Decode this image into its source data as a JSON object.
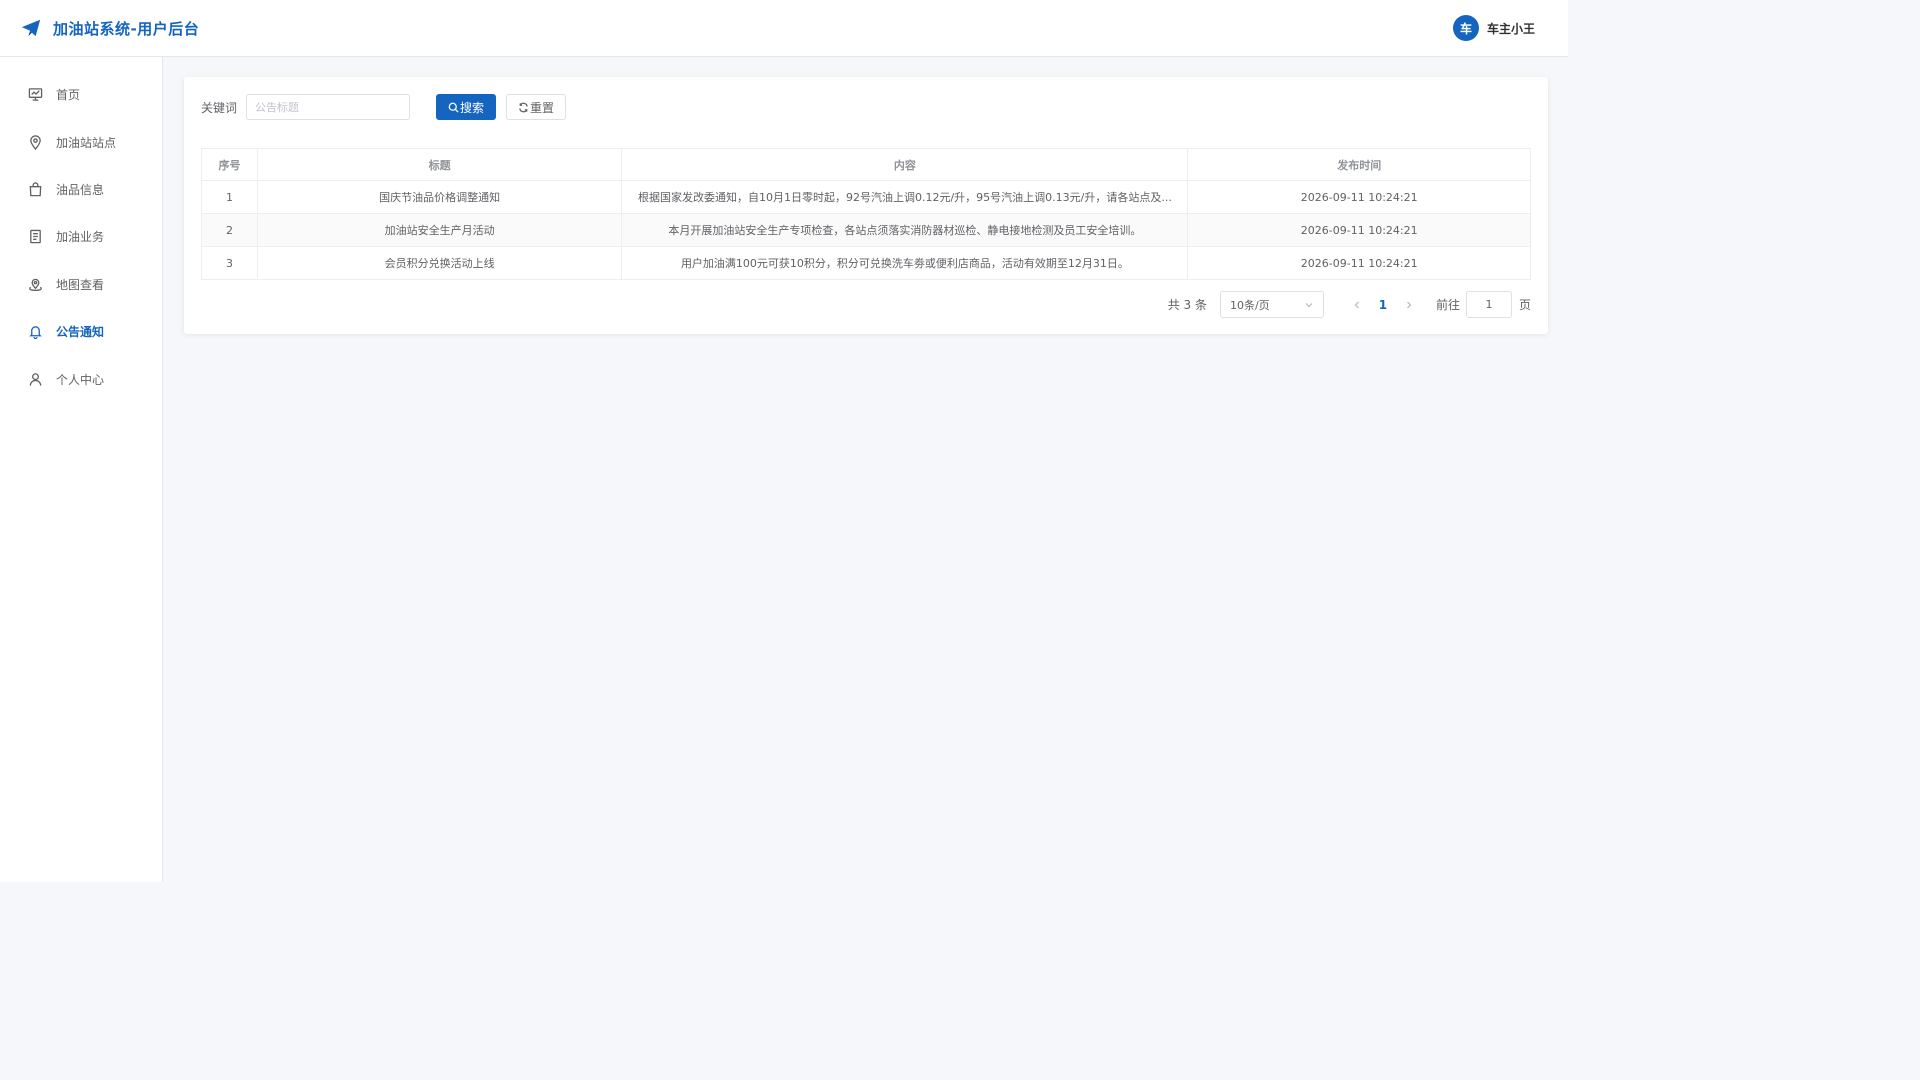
{
  "header": {
    "title": "加油站系统-用户后台",
    "user": {
      "avatar_text": "车",
      "name": "车主小王"
    }
  },
  "sidebar": {
    "items": [
      {
        "label": "首页",
        "icon": "dashboard-icon"
      },
      {
        "label": "加油站站点",
        "icon": "location-pin-icon"
      },
      {
        "label": "油品信息",
        "icon": "shopping-bag-icon"
      },
      {
        "label": "加油业务",
        "icon": "document-list-icon"
      },
      {
        "label": "地图查看",
        "icon": "map-pin-icon"
      },
      {
        "label": "公告通知",
        "icon": "bell-icon",
        "active": true
      },
      {
        "label": "个人中心",
        "icon": "user-icon"
      }
    ]
  },
  "search": {
    "label": "关键词",
    "placeholder": "公告标题",
    "value": "",
    "search_button": "搜索",
    "reset_button": "重置"
  },
  "table": {
    "columns": [
      "序号",
      "标题",
      "内容",
      "发布时间"
    ],
    "rows": [
      {
        "index": "1",
        "title": "国庆节油品价格调整通知",
        "content": "根据国家发改委通知，自10月1日零时起，92号汽油上调0.12元/升，95号汽油上调0.13元/升，请各站点及...",
        "time": "2026-09-11 10:24:21"
      },
      {
        "index": "2",
        "title": "加油站安全生产月活动",
        "content": "本月开展加油站安全生产专项检查，各站点须落实消防器材巡检、静电接地检测及员工安全培训。",
        "time": "2026-09-11 10:24:21"
      },
      {
        "index": "3",
        "title": "会员积分兑换活动上线",
        "content": "用户加油满100元可获10积分，积分可兑换洗车劵或便利店商品，活动有效期至12月31日。",
        "time": "2026-09-11 10:24:21"
      }
    ]
  },
  "pagination": {
    "total": "共 3 条",
    "page_size": "10条/页",
    "current_page": "1",
    "goto_label": "前往",
    "goto_value": "1",
    "page_suffix": "页"
  },
  "colors": {
    "brand": "#1565c0",
    "background": "#f5f7fa",
    "border": "#ebeef5"
  }
}
